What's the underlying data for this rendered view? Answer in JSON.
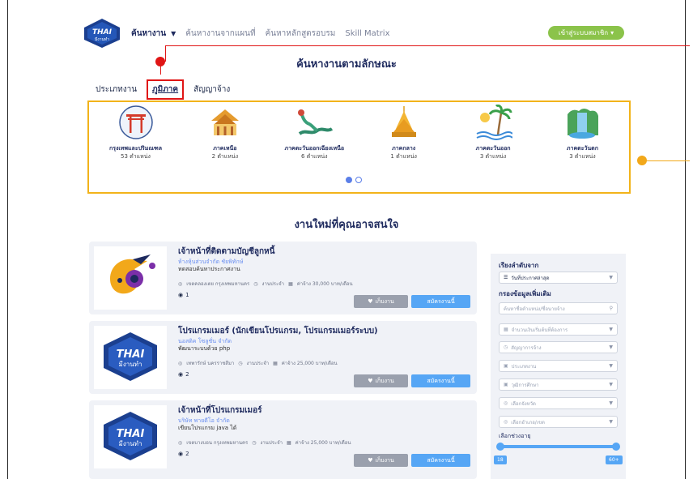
{
  "nav": {
    "logo_text": "THAI",
    "logo_sub": "มีงานทำ",
    "items": [
      {
        "label": "ค้นหางาน",
        "active": true
      },
      {
        "label": "ค้นหางานจากแผนที่"
      },
      {
        "label": "ค้นหาหลักสูตรอบรม"
      },
      {
        "label": "Skill Matrix"
      }
    ],
    "login_label": "เข้าสู่ระบบสมาชิก"
  },
  "search_section": {
    "title": "ค้นหางานตามลักษณะ",
    "tabs": [
      "ประเภทงาน",
      "ภูมิภาค",
      "สัญญาจ้าง"
    ],
    "active_tab": "ภูมิภาค"
  },
  "regions": [
    {
      "name": "กรุงเทพและปริมณฑล",
      "count": "53 ตำแหน่ง",
      "icon": "gate-icon"
    },
    {
      "name": "ภาคเหนือ",
      "count": "2 ตำแหน่ง",
      "icon": "temple-icon"
    },
    {
      "name": "ภาคตะวันออกเฉียงเหนือ",
      "count": "6 ตำแหน่ง",
      "icon": "naga-icon"
    },
    {
      "name": "ภาคกลาง",
      "count": "1 ตำแหน่ง",
      "icon": "pagoda-icon"
    },
    {
      "name": "ภาคตะวันออก",
      "count": "3 ตำแหน่ง",
      "icon": "palm-beach-icon"
    },
    {
      "name": "ภาคตะวันตก",
      "count": "3 ตำแหน่ง",
      "icon": "waterfall-icon"
    }
  ],
  "jobs_section": {
    "title": "งานใหม่ที่คุณอาจสนใจ"
  },
  "jobs": [
    {
      "title": "เจ้าหน้าที่ติดตามบัญชีลูกหนี้",
      "company": "ห้างหุ้นส่วนจำกัด ชัยพิทักษ์",
      "desc": "ทดสอบค้นหาประกาศงาน",
      "location": "เขตคลองเตย กรุงเทพมหานคร",
      "type": "งานประจำ",
      "salary": "ค่าจ้าง 30,000 บาท/เดือน",
      "views": "1",
      "logo": "parrot-logo"
    },
    {
      "title": "โปรแกรมเมอร์ (นักเขียนโปรแกรม, โปรแกรมเมอร์ระบบ)",
      "company": "นอสติค โซลูชั่น จำกัด",
      "desc": "พัฒนาระบบด้วย php",
      "location": "เทพารักษ์ นครราชสีมา",
      "type": "งานประจำ",
      "salary": "ค่าจ้าง 25,000 บาท/เดือน",
      "views": "2",
      "logo": "thai-logo"
    },
    {
      "title": "เจ้าหน้าที่โปรแกรมเมอร์",
      "company": "บริษัท พายดีโอ จำกัด",
      "desc": "เขียนโปรแกรม java ได้",
      "location": "เขตบางบอน กรุงเทพมหานคร",
      "type": "งานประจำ",
      "salary": "ค่าจ้าง 25,000 บาท/เดือน",
      "views": "2",
      "logo": "thai-logo"
    }
  ],
  "job_buttons": {
    "save": "เก็บงาน",
    "apply": "สมัครงานนี้"
  },
  "sidebar": {
    "sort_label": "เรียงลำดับจาก",
    "sort_value": "วันที่ประกาศล่าสุด",
    "filter_label": "กรองข้อมูลเพิ่มเติม",
    "search_placeholder": "ค้นหาชื่อตำแหน่ง/ชื่อนายจ้าง",
    "filters": [
      "จำนวนเงินเริ่มต้นที่ต้องการ",
      "สัญญาการจ้าง",
      "ประเภทงาน",
      "วุฒิการศึกษา",
      "เลือกจังหวัด",
      "เลือกอำเภอ/เขต"
    ],
    "age_label": "เลือกช่วงอายุ",
    "age_min": "18",
    "age_max": "60+"
  }
}
